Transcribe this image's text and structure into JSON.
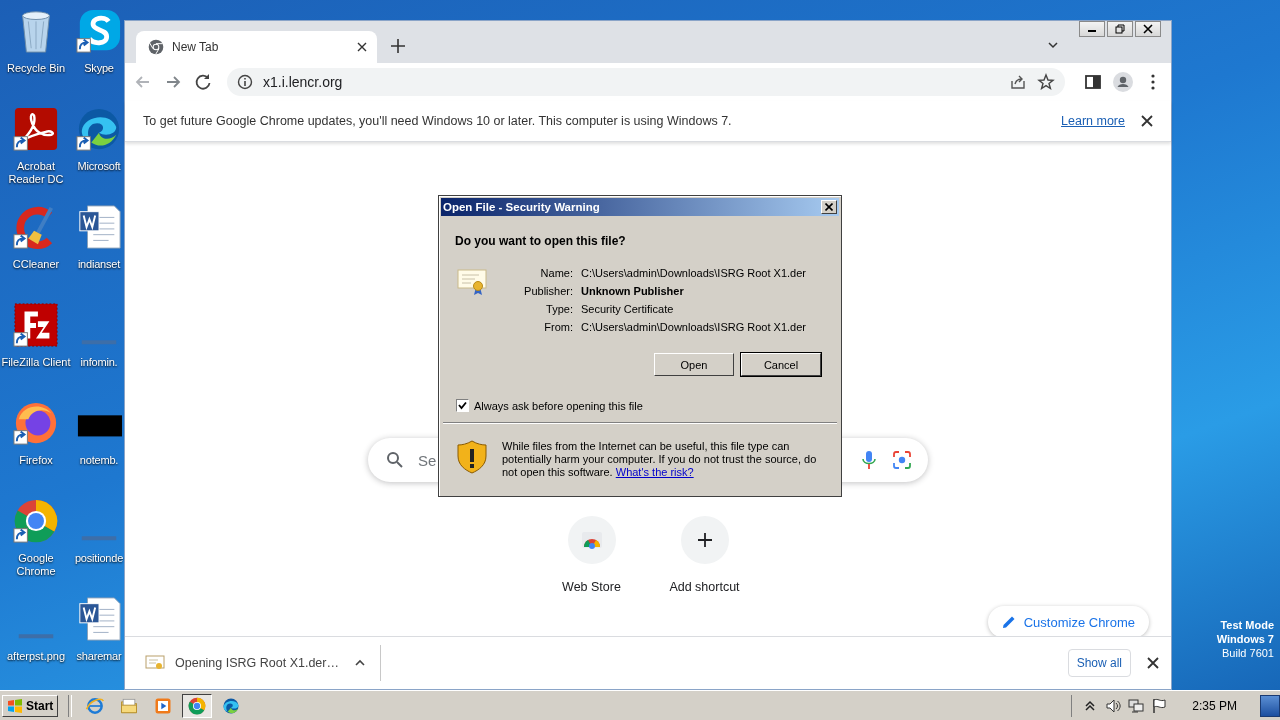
{
  "desktop": {
    "icon_columns": [
      {
        "icons": [
          {
            "label": "Recycle Bin",
            "kind": "recycle",
            "shortcut": false
          },
          {
            "label": "Acrobat Reader DC",
            "kind": "acrobat",
            "shortcut": true
          },
          {
            "label": "CCleaner",
            "kind": "ccleaner",
            "shortcut": true
          },
          {
            "label": "FileZilla Client",
            "kind": "filezilla",
            "shortcut": true
          },
          {
            "label": "Firefox",
            "kind": "firefox",
            "shortcut": true
          },
          {
            "label": "Google Chrome",
            "kind": "chrome",
            "shortcut": true
          },
          {
            "label": "afterpst.png",
            "kind": "blank",
            "shortcut": false
          }
        ]
      },
      {
        "icons": [
          {
            "label": "Skype",
            "kind": "skype",
            "shortcut": true
          },
          {
            "label": "Microsoft",
            "kind": "edge",
            "shortcut": true
          },
          {
            "label": "indianset",
            "kind": "word",
            "shortcut": false
          },
          {
            "label": "infomin.",
            "kind": "blank",
            "shortcut": false
          },
          {
            "label": "notemb.",
            "kind": "black",
            "shortcut": false
          },
          {
            "label": "positionde",
            "kind": "blank",
            "shortcut": false
          },
          {
            "label": "sharemar",
            "kind": "word",
            "shortcut": false
          }
        ]
      }
    ],
    "watermark": [
      "Test Mode",
      "Windows 7",
      "Build 7601"
    ]
  },
  "browser": {
    "tabs": [
      {
        "label": "New Tab",
        "selected": true
      }
    ],
    "address": "x1.i.lencr.org",
    "infobar": {
      "text": "To get future Google Chrome updates, you'll need Windows 10 or later. This computer is using Windows 7.",
      "link": "Learn more"
    },
    "search": {
      "placeholder": "Se"
    },
    "shortcuts": [
      {
        "label": "Web Store",
        "kind": "webstore"
      },
      {
        "label": "Add shortcut",
        "kind": "add"
      }
    ],
    "customize": "Customize Chrome",
    "download_bar": {
      "item": "Opening ISRG Root X1.der…",
      "show_all": "Show all"
    }
  },
  "dialog": {
    "title": "Open File - Security Warning",
    "question": "Do you want to open this file?",
    "fields": [
      {
        "label": "Name:",
        "value": "C:\\Users\\admin\\Downloads\\ISRG Root X1.der",
        "kind": "plain"
      },
      {
        "label": "Publisher:",
        "value": "Unknown Publisher",
        "kind": "bold"
      },
      {
        "label": "Type:",
        "value": "Security Certificate",
        "kind": "plain"
      },
      {
        "label": "From:",
        "value": "C:\\Users\\admin\\Downloads\\ISRG Root X1.der",
        "kind": "plain"
      }
    ],
    "buttons": [
      {
        "label": "Open",
        "default": false
      },
      {
        "label": "Cancel",
        "default": true
      }
    ],
    "checkbox": {
      "label": "Always ask before opening this file",
      "checked": true
    },
    "warning": {
      "text": "While files from the Internet can be useful, this file type can potentially harm your computer. If you do not trust the source, do not open this software.",
      "link": "What's the risk?"
    }
  },
  "taskbar": {
    "start": "Start",
    "apps": [
      {
        "kind": "ie",
        "selected": false
      },
      {
        "kind": "explorer",
        "selected": false
      },
      {
        "kind": "media",
        "selected": false
      },
      {
        "kind": "chrome",
        "selected": true
      },
      {
        "kind": "edge",
        "selected": false
      }
    ],
    "tray": [
      {
        "kind": "expand"
      },
      {
        "kind": "volume"
      },
      {
        "kind": "network"
      },
      {
        "kind": "flag"
      }
    ],
    "time": "2:35 PM"
  }
}
